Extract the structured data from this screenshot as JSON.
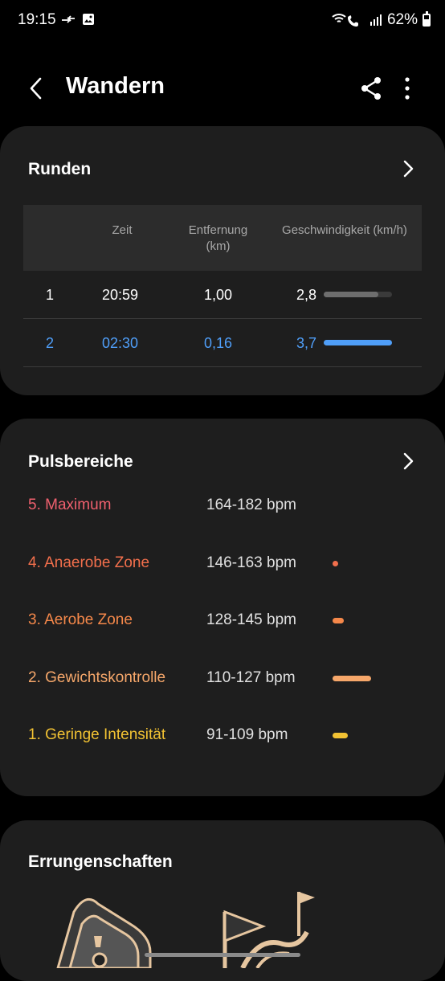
{
  "status": {
    "time": "19:15",
    "battery": "62%"
  },
  "header": {
    "title": "Wandern"
  },
  "laps": {
    "title": "Runden",
    "columns": [
      "Zeit",
      "Entfernung\n(km)",
      "Geschwindigkeit (km/h)"
    ],
    "rows": [
      {
        "lap": "1",
        "time": "20:59",
        "distance": "1,00",
        "speed": "2,8",
        "speed_fraction": 0.8,
        "color": "#6e6e6e",
        "text_color": "#ffffff"
      },
      {
        "lap": "2",
        "time": "02:30",
        "distance": "0,16",
        "speed": "3,7",
        "speed_fraction": 1.0,
        "color": "#4f9ef8",
        "text_color": "#4f9ef8"
      }
    ]
  },
  "zones": {
    "title": "Pulsbereiche",
    "items": [
      {
        "name": "5. Maximum",
        "range": "164-182 bpm",
        "color": "#f0606e",
        "share": 0.0
      },
      {
        "name": "4. Anaerobe Zone",
        "range": "146-163 bpm",
        "color": "#f26f4c",
        "share": 0.05
      },
      {
        "name": "3. Aerobe Zone",
        "range": "128-145 bpm",
        "color": "#f5884a",
        "share": 0.15
      },
      {
        "name": "2. Gewichtskontrolle",
        "range": "110-127 bpm",
        "color": "#f6a76a",
        "share": 0.5
      },
      {
        "name": "1. Geringe Intensität",
        "range": "91-109 bpm",
        "color": "#f2c233",
        "share": 0.2
      }
    ]
  },
  "achievements": {
    "title": "Errungenschaften"
  },
  "icons": [
    "back-icon",
    "share-icon",
    "more-icon",
    "chevron-right-icon",
    "wifi-call-icon",
    "signal-icon",
    "battery-icon",
    "image-icon",
    "arrow-swap-icon"
  ]
}
